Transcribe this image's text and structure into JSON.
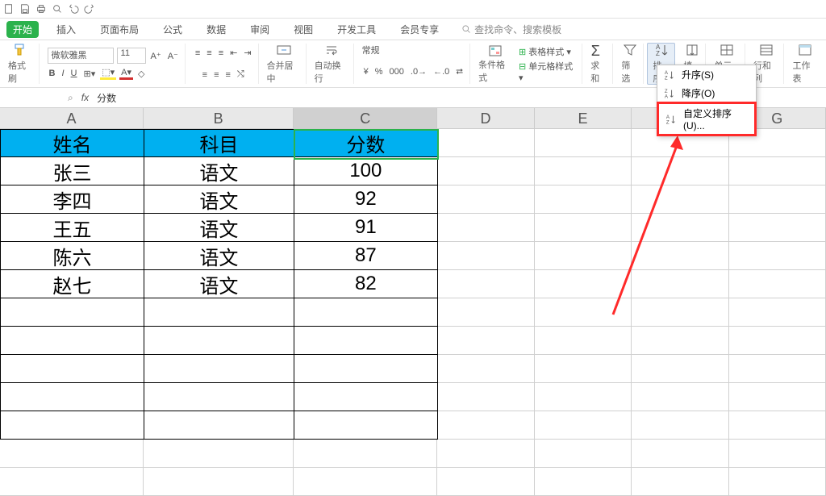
{
  "tabs": {
    "start": "开始",
    "insert": "插入",
    "layout": "页面布局",
    "formula": "公式",
    "data": "数据",
    "review": "审阅",
    "view": "视图",
    "dev": "开发工具",
    "member": "会员专享"
  },
  "search_placeholder": "查找命令、搜索模板",
  "ribbon": {
    "format_painter": "格式刷",
    "font_name": "微软雅黑",
    "font_size": "11",
    "merge_center": "合并居中",
    "wrap": "自动换行",
    "number_format": "常规",
    "cond_format": "条件格式",
    "table_style": "表格样式",
    "cell_style": "单元格样式",
    "sum": "求和",
    "filter": "筛选",
    "sort": "排序",
    "fill": "填充",
    "cells": "单元格",
    "rowscols": "行和列",
    "worksheet": "工作表"
  },
  "currency_symbol": "¥",
  "fx_label": "fx",
  "fx_value": "分数",
  "cols": [
    "A",
    "B",
    "C",
    "D",
    "E",
    "F",
    "G"
  ],
  "table": {
    "headers": {
      "name": "姓名",
      "subject": "科目",
      "score": "分数"
    },
    "rows": [
      {
        "name": "张三",
        "subject": "语文",
        "score": "100"
      },
      {
        "name": "李四",
        "subject": "语文",
        "score": "92"
      },
      {
        "name": "王五",
        "subject": "语文",
        "score": "91"
      },
      {
        "name": "陈六",
        "subject": "语文",
        "score": "87"
      },
      {
        "name": "赵七",
        "subject": "语文",
        "score": "82"
      }
    ]
  },
  "sort_menu": {
    "asc": "升序(S)",
    "desc": "降序(O)",
    "custom": "自定义排序(U)..."
  },
  "chart_data": {
    "type": "table",
    "columns": [
      "姓名",
      "科目",
      "分数"
    ],
    "rows": [
      [
        "张三",
        "语文",
        100
      ],
      [
        "李四",
        "语文",
        92
      ],
      [
        "王五",
        "语文",
        91
      ],
      [
        "陈六",
        "语文",
        87
      ],
      [
        "赵七",
        "语文",
        82
      ]
    ]
  }
}
